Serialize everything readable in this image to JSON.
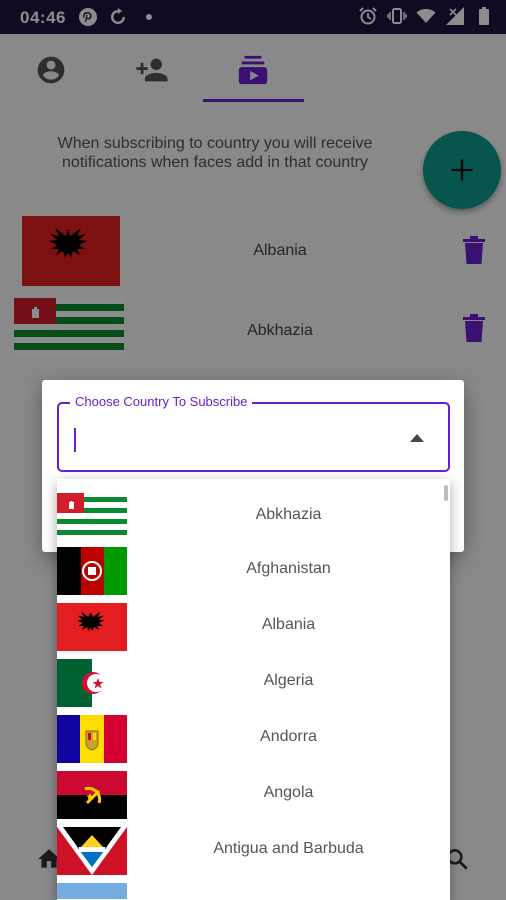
{
  "status_bar": {
    "time": "04:46",
    "left_icons": [
      "pinterest-icon",
      "sync-icon",
      "dot-icon"
    ],
    "right_icons": [
      "alarm-icon",
      "vibrate-icon",
      "wifi-icon",
      "signal-icon",
      "battery-icon"
    ]
  },
  "tabs": [
    {
      "icon": "account-circle-icon",
      "selected": false
    },
    {
      "icon": "person-add-icon",
      "selected": false
    },
    {
      "icon": "subscriptions-icon",
      "selected": true
    }
  ],
  "info_text": "When subscribing to country you will receive notifications when faces add in that country",
  "fab": {
    "icon": "plus-icon"
  },
  "subscriptions": [
    {
      "name": "Albania",
      "flag": "albania"
    },
    {
      "name": "Abkhazia",
      "flag": "abkhazia"
    }
  ],
  "dialog": {
    "field_label": "Choose Country To Subscribe",
    "field_value": ""
  },
  "dropdown_options": [
    {
      "name": "Abkhazia",
      "flag": "abkhazia"
    },
    {
      "name": "Afghanistan",
      "flag": "afghanistan"
    },
    {
      "name": "Albania",
      "flag": "albania"
    },
    {
      "name": "Algeria",
      "flag": "algeria"
    },
    {
      "name": "Andorra",
      "flag": "andorra"
    },
    {
      "name": "Angola",
      "flag": "angola"
    },
    {
      "name": "Antigua and Barbuda",
      "flag": "antigua-and-barbuda"
    }
  ],
  "colors": {
    "accent": "#6a1ed1",
    "fab": "#0b9d8c",
    "status_bar": "#23123f"
  }
}
